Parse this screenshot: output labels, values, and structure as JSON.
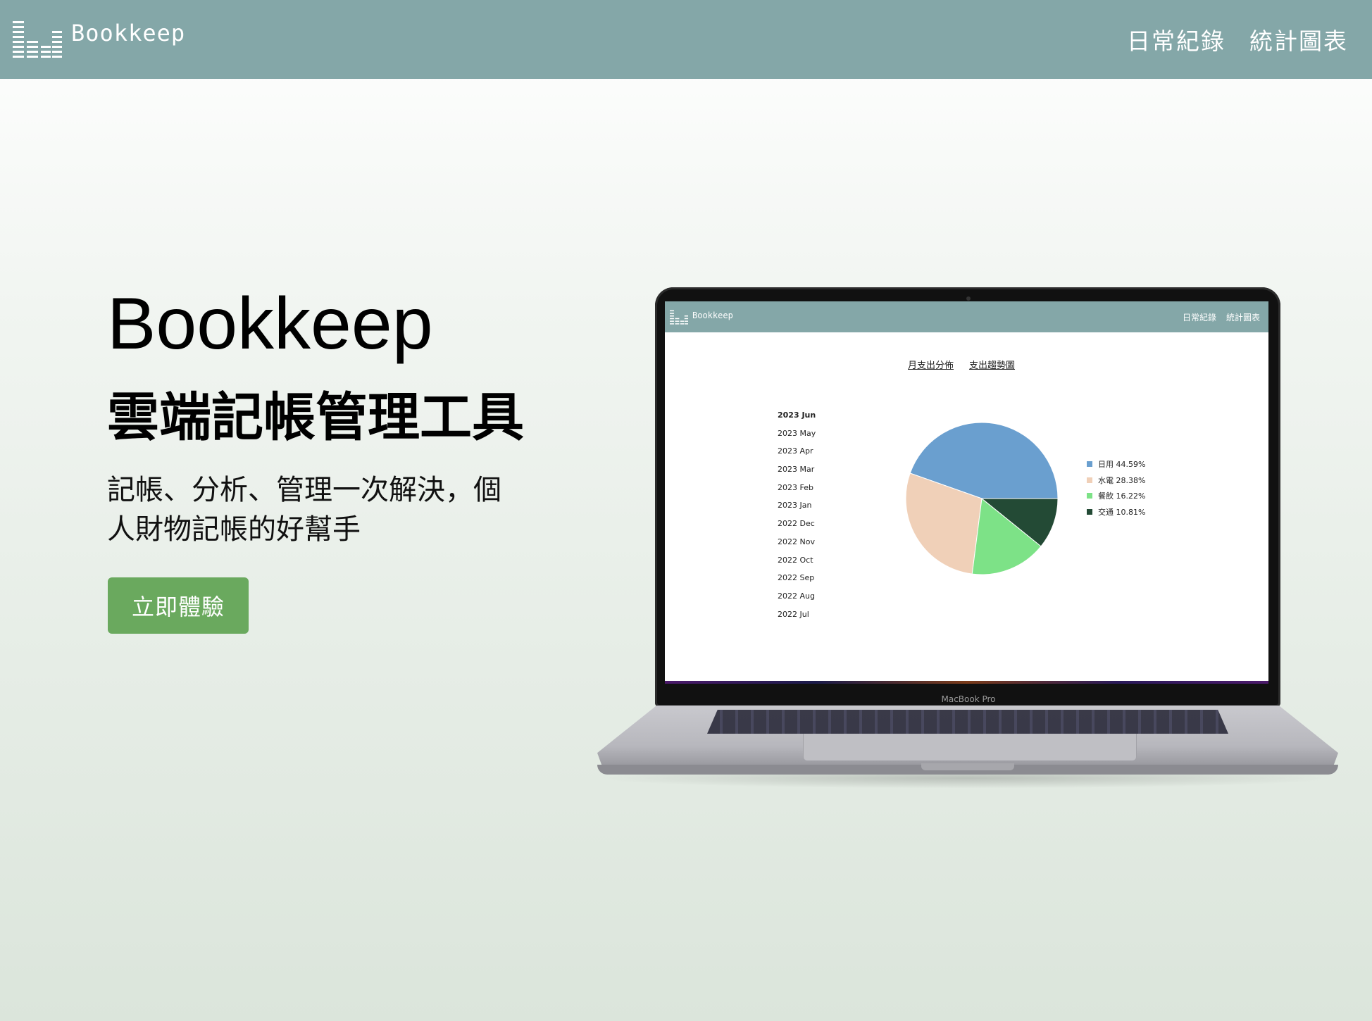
{
  "header": {
    "brand": "Bookkeep",
    "nav": [
      "日常紀錄",
      "統計圖表"
    ]
  },
  "hero": {
    "title": "Bookkeep",
    "subtitle": "雲端記帳管理工具",
    "description_line1": "記帳、分析、管理一次解決，個",
    "description_line2": "人財物記帳的好幫手",
    "cta_label": "立即體驗"
  },
  "mockup": {
    "device_label": "MacBook Pro",
    "app": {
      "brand": "Bookkeep",
      "nav": [
        "日常紀錄",
        "統計圖表"
      ],
      "tabs": [
        "月支出分佈",
        "支出趨勢圖"
      ],
      "months": [
        "2023 Jun",
        "2023 May",
        "2023 Apr",
        "2023 Mar",
        "2023 Feb",
        "2023 Jan",
        "2022 Dec",
        "2022 Nov",
        "2022 Oct",
        "2022 Sep",
        "2022 Aug",
        "2022 Jul"
      ],
      "selected_month": "2023 Jun",
      "legend": [
        "日用 44.59%",
        "水電 28.38%",
        "餐飲 16.22%",
        "交通 10.81%"
      ]
    }
  },
  "colors": {
    "header_bg": "#84a7a8",
    "cta_bg": "#6aa95e"
  },
  "chart_data": {
    "type": "pie",
    "categories": [
      "日用",
      "水電",
      "餐飲",
      "交通"
    ],
    "values": [
      44.59,
      28.38,
      16.22,
      10.81
    ],
    "colors": [
      "#6a9fcf",
      "#f0d0b8",
      "#7de287",
      "#234a35"
    ]
  }
}
